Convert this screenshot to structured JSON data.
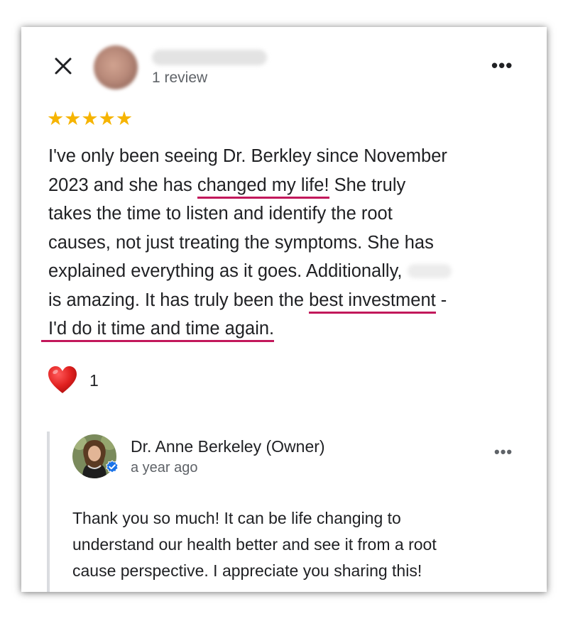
{
  "review": {
    "close_icon": "close-icon",
    "review_count": "1 review",
    "more_icon": "more-horizontal-icon",
    "rating": 5,
    "stars": "★★★★★",
    "star_color": "#f6b400",
    "text": {
      "line1": "I've only been seeing Dr. Berkley since November",
      "line2_a": "2023 and she has ",
      "line2_hl": "changed my life!",
      "line2_b": " She truly",
      "line3": "takes the time to listen and identify the root",
      "line4": "causes, not just treating the symptoms. She has",
      "line5": "explained everything as it goes. Additionally, ",
      "line6_a": "is amazing. It has truly been the ",
      "line6_hl": "best investment",
      "line6_b": " -",
      "line7_hl": "I'd do it time and time again."
    },
    "highlight_color": "#c2185b",
    "reaction_icon": "heart-icon",
    "reaction_count": "1"
  },
  "reply": {
    "owner_name": "Dr. Anne Berkeley (Owner)",
    "time": "a year ago",
    "more_icon": "more-horizontal-icon",
    "verified_icon": "verified-badge-icon",
    "text": {
      "line1": "Thank you so much! It can be life changing to",
      "line2": "understand our health better and see it from a root",
      "line3": "cause perspective. I appreciate you sharing this!"
    }
  }
}
